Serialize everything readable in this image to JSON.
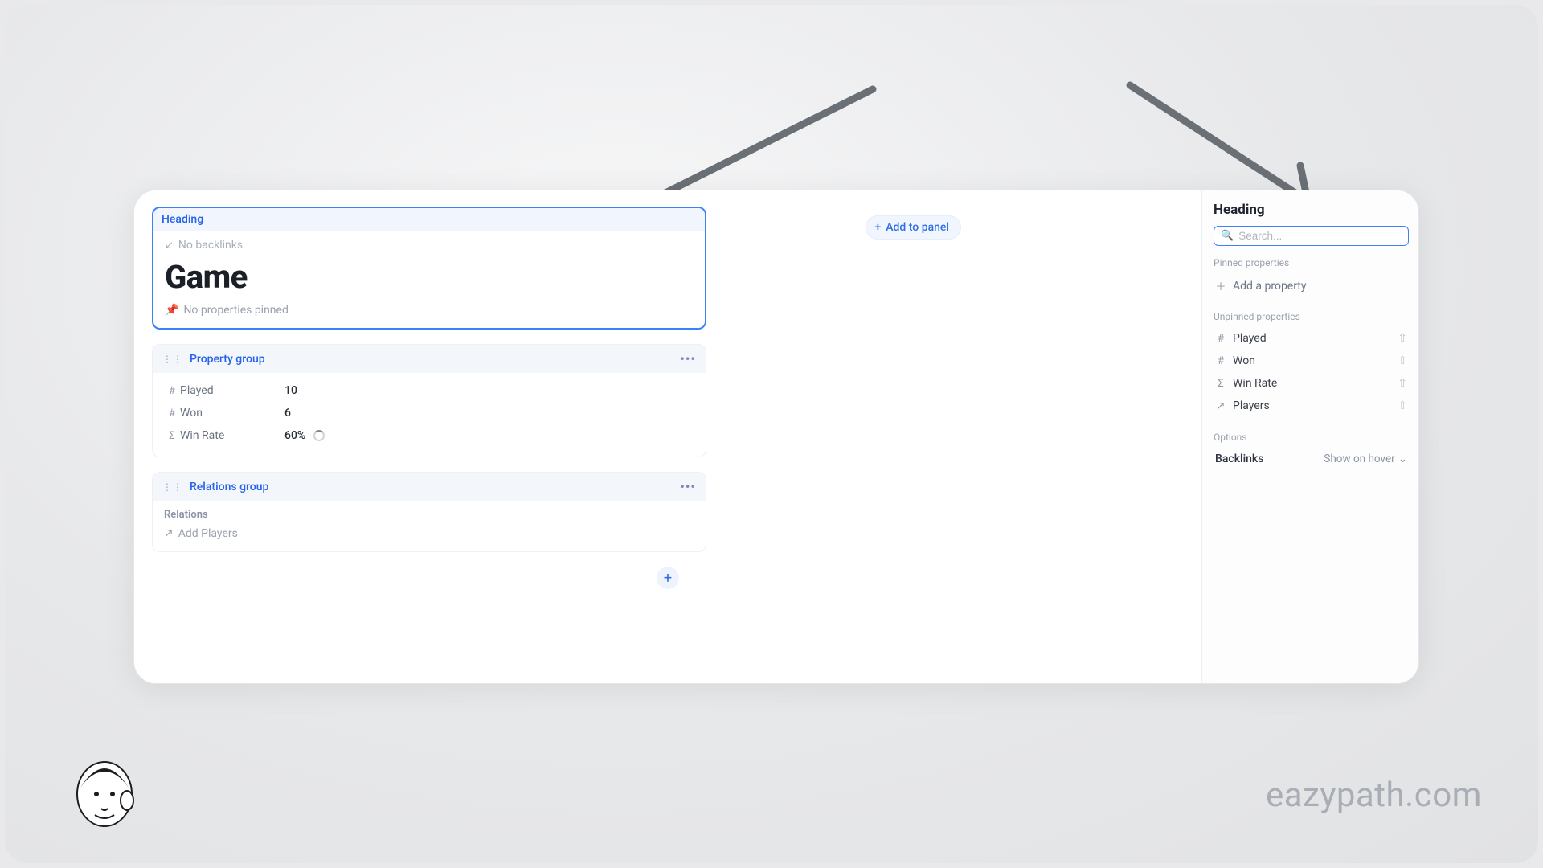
{
  "main": {
    "heading_label": "Heading",
    "no_backlinks": "No backlinks",
    "title": "Game",
    "no_pinned": "No properties pinned",
    "add_to_panel": "Add to panel",
    "add_block_plus": "+"
  },
  "property_group": {
    "label": "Property group",
    "rows": [
      {
        "icon": "#",
        "name": "Played",
        "value": "10"
      },
      {
        "icon": "#",
        "name": "Won",
        "value": "6"
      },
      {
        "icon": "Σ",
        "name": "Win Rate",
        "value": "60%"
      }
    ]
  },
  "relations_group": {
    "label": "Relations group",
    "sub": "Relations",
    "add_label": "Add Players"
  },
  "side": {
    "title": "Heading",
    "search_placeholder": "Search...",
    "pinned_label": "Pinned properties",
    "add_property": "Add a property",
    "unpinned_label": "Unpinned properties",
    "props": [
      {
        "icon": "#",
        "name": "Played"
      },
      {
        "icon": "#",
        "name": "Won"
      },
      {
        "icon": "Σ",
        "name": "Win Rate"
      },
      {
        "icon": "↗",
        "name": "Players"
      }
    ],
    "options_label": "Options",
    "backlinks_label": "Backlinks",
    "backlinks_value": "Show on hover"
  },
  "watermark": "eazypath.com"
}
